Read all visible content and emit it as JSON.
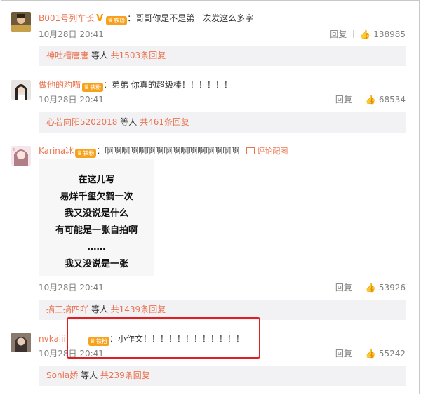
{
  "comments": [
    {
      "username": "B001号列车长",
      "has_v_badge": true,
      "v_badge": "V",
      "fan_badge": "铁粉",
      "text": "：哥哥你是不是第一次发这么多字",
      "time": "10月28日 20:41",
      "reply_label": "回复",
      "likes": "138985",
      "replies": {
        "who": "神吐槽唐唐",
        "middle": " 等人 ",
        "count": "共1503条回复"
      }
    },
    {
      "username": "做他的豹喵",
      "fan_badge": "铁粉",
      "text": "：弟弟 你真的超级棒！！！！！！",
      "time": "10月28日 20:41",
      "reply_label": "回复",
      "likes": "68534",
      "replies": {
        "who": "心若向阳5202018",
        "middle": " 等人 ",
        "count": "共461条回复"
      }
    },
    {
      "username": "Karina冰",
      "fan_badge": "铁粉",
      "text": "：啊啊啊啊啊啊啊啊啊啊啊啊啊啊啊啊",
      "pic_link": "评论配图",
      "image_lines": [
        "在这儿写",
        "易烊千玺欠鹤一次",
        "我又没说是什么",
        "有可能是一张自拍啊",
        "……",
        "我又没说是一张"
      ],
      "time": "10月28日 20:41",
      "reply_label": "回复",
      "likes": "53926",
      "replies": {
        "who": "搞三搞四吖",
        "middle": " 等人 ",
        "count": "共1439条回复"
      }
    },
    {
      "username": "nvkaiii",
      "fan_badge": "铁粉",
      "text": "：小作文！！！！！！！！！！！！",
      "time": "10月28日 20:41",
      "reply_label": "回复",
      "likes": "55242",
      "replies": {
        "who": "Sonia娇",
        "middle": " 等人 ",
        "count": "共239条回复"
      }
    }
  ],
  "colors": {
    "accent": "#eb7350",
    "highlight_box": "#e02020",
    "badge": "#f6a21e"
  },
  "icons": {
    "like": "thumb-up-icon",
    "picture": "picture-icon",
    "crown": "crown-icon"
  }
}
